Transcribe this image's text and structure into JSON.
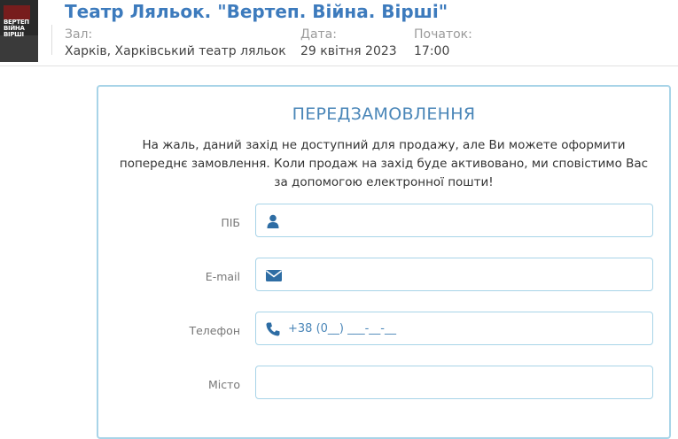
{
  "event": {
    "title": "Театр Ляльок. \"Вертеп. Війна. Вірші\"",
    "poster_text": "ВЕРТЕП ВІЙНА ВІРШІ",
    "hall_label": "Зал:",
    "hall_value": "Харків, Харківський театр ляльок",
    "date_label": "Дата:",
    "date_value": "29 квітня 2023",
    "time_label": "Початок:",
    "time_value": "17:00"
  },
  "preorder": {
    "title": "ПЕРЕДЗАМОВЛЕННЯ",
    "message": "На жаль, даний захід не доступний для продажу, але Ви можете оформити попереднє замовлення. Коли продаж на захід буде активовано, ми сповістимо Вас за допомогою електронної пошти!",
    "fields": {
      "name": {
        "label": "ПІБ",
        "value": "",
        "placeholder": "",
        "icon": "user-icon"
      },
      "email": {
        "label": "E-mail",
        "value": "",
        "placeholder": "",
        "icon": "envelope-icon"
      },
      "phone": {
        "label": "Телефон",
        "value": "",
        "placeholder": "+38 (0__) ___-__-__",
        "icon": "phone-icon"
      },
      "city": {
        "label": "Місто",
        "value": "",
        "placeholder": ""
      }
    }
  },
  "colors": {
    "accent": "#3d7bbd",
    "icon": "#2e6da4",
    "border": "#a8d4e8"
  }
}
